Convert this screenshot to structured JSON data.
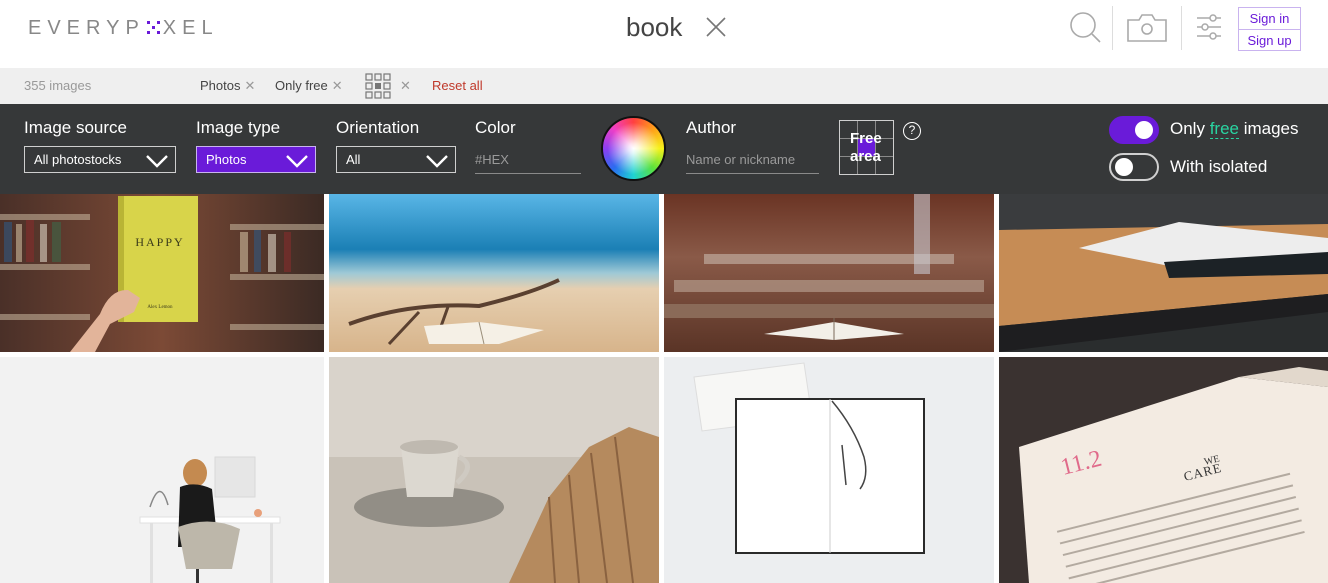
{
  "header": {
    "logo": "EVERYPIXEL",
    "logo_parts": [
      "EVERYP",
      "XEL"
    ],
    "search_query": "book",
    "sign_in": "Sign in",
    "sign_up": "Sign up",
    "accent_color": "#6a1bd9"
  },
  "summary": {
    "count": "355 images",
    "chips": [
      "Photos",
      "Only free"
    ],
    "reset": "Reset all"
  },
  "filters": {
    "image_source": {
      "label": "Image source",
      "value": "All photostocks"
    },
    "image_type": {
      "label": "Image type",
      "value": "Photos"
    },
    "orientation": {
      "label": "Orientation",
      "value": "All"
    },
    "color": {
      "label": "Color",
      "placeholder": "#HEX"
    },
    "author": {
      "label": "Author",
      "placeholder": "Name or nickname"
    },
    "free_area": "Free area",
    "free_area_lines": [
      "Free",
      "area"
    ],
    "help": "?",
    "only_free": {
      "pre": "Only ",
      "highlight": "free",
      "post": " images",
      "on": true
    },
    "with_isolated": {
      "label": "With isolated",
      "on": false
    }
  },
  "images": [
    {
      "alt": "Hand holding yellow book in library",
      "cover_title": "HAPPY",
      "cover_author": "Alex Lemon"
    },
    {
      "alt": "Open book on sandy beach"
    },
    {
      "alt": "Open book on wooden bench"
    },
    {
      "alt": "Open book on wooden desk"
    },
    {
      "alt": "Woman sitting at white desk"
    },
    {
      "alt": "Coffee cup and open book"
    },
    {
      "alt": "Open notebook with ribbon"
    },
    {
      "alt": "Close-up of open book page",
      "page_number": "11.2",
      "page_heading_1": "WE",
      "page_heading_2": "CARE"
    }
  ]
}
